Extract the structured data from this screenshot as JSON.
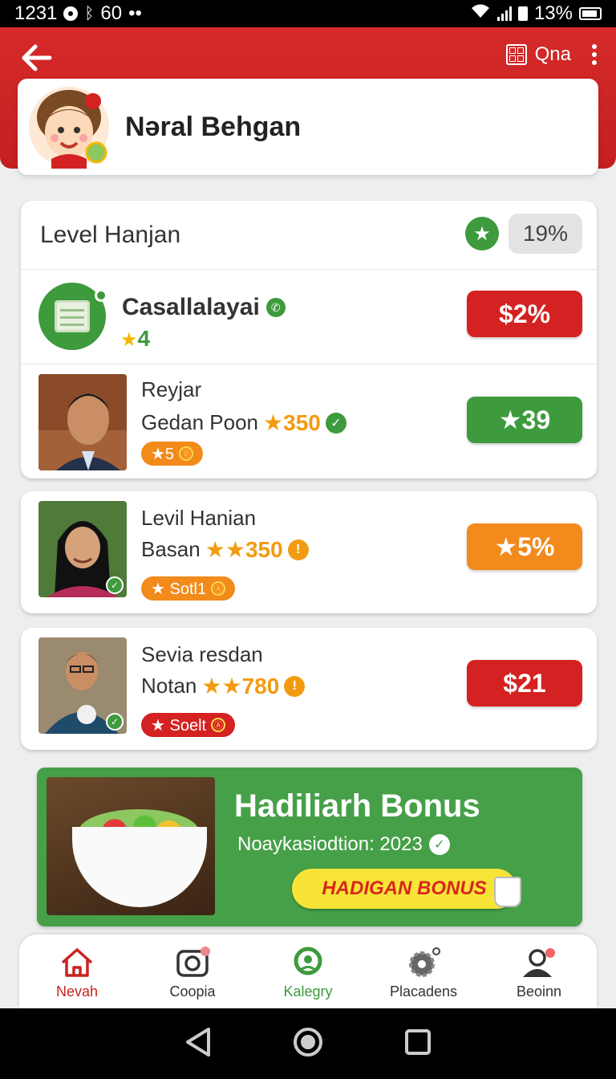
{
  "status_bar": {
    "time": "1231",
    "signal_value": "60",
    "dots": "••",
    "battery_text": "13%"
  },
  "header": {
    "top_right_label": "Qna"
  },
  "profile": {
    "name": "Nəral Behgan"
  },
  "level_section": {
    "title": "Level Hanjan",
    "percent": "19%",
    "category": {
      "title": "Casallalayai",
      "rating": "4",
      "price": "$2%"
    }
  },
  "people": [
    {
      "name": "Reyjar",
      "subtitle": "Gedan Poon",
      "points": "★350",
      "tag": "★5",
      "tag_mark": "⓪",
      "price": "★39",
      "price_color": "#3d9a3d",
      "badge": "check"
    },
    {
      "name": "Levil Hanian",
      "subtitle": "Basan",
      "points": "★★350",
      "tag": "★ Sotl1",
      "tag_mark": "Ⓐ",
      "price": "★5%",
      "price_color": "#f28a1c",
      "badge": "info"
    },
    {
      "name": "Sevia resdan",
      "subtitle": "Notan",
      "points": "★★780",
      "tag": "★ Soelt",
      "tag_mark": "Ⓐ",
      "price": "$21",
      "price_color": "#d42121",
      "badge": "info"
    }
  ],
  "banner": {
    "title": "Hadiliarh Bonus",
    "subtitle": "Noaykasiodtion: 2023",
    "button": "HADIGAN BONUS"
  },
  "bottom_nav": [
    {
      "label": "Nevah",
      "icon": "home-icon"
    },
    {
      "label": "Coopia",
      "icon": "camera-icon"
    },
    {
      "label": "Kalegry",
      "icon": "location-icon"
    },
    {
      "label": "Placadens",
      "icon": "gear-icon"
    },
    {
      "label": "Beoinn",
      "icon": "profile-icon"
    }
  ],
  "colors": {
    "brand_red": "#d42121",
    "brand_green": "#3d9a3d",
    "accent_orange": "#f28a1c",
    "bonus_yellow": "#f7e437"
  }
}
